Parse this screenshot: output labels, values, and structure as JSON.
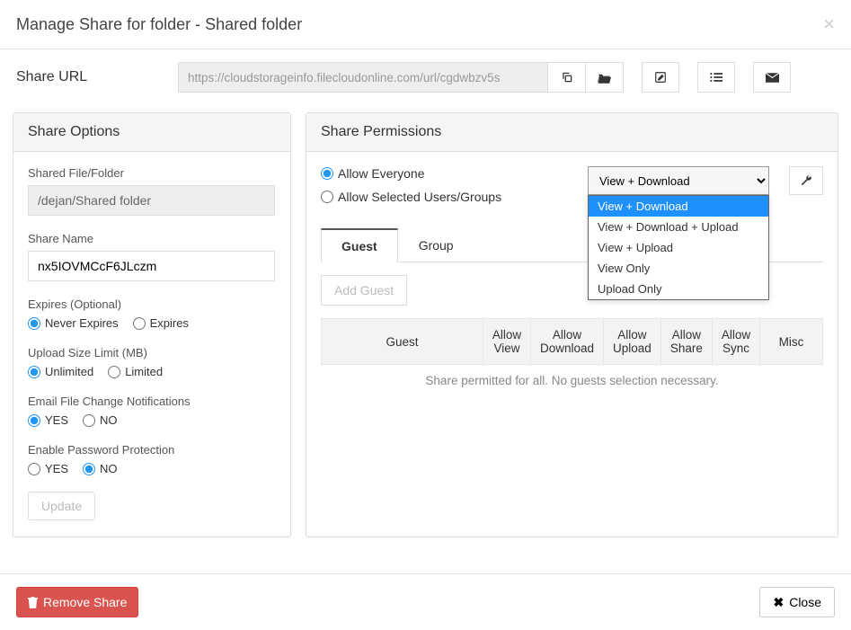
{
  "header": {
    "title": "Manage Share for folder - Shared folder"
  },
  "share_url": {
    "label": "Share URL",
    "value": "https://cloudstorageinfo.filecloudonline.com/url/cgdwbzv5s"
  },
  "share_options": {
    "heading": "Share Options",
    "shared_file": {
      "label": "Shared File/Folder",
      "value": "/dejan/Shared folder"
    },
    "share_name": {
      "label": "Share Name",
      "value": "nx5IOVMCcF6JLczm"
    },
    "expires": {
      "label": "Expires (Optional)",
      "never": "Never Expires",
      "expires": "Expires"
    },
    "upload": {
      "label": "Upload Size Limit (MB)",
      "unlimited": "Unlimited",
      "limited": "Limited"
    },
    "email_notif": {
      "label": "Email File Change Notifications",
      "yes": "YES",
      "no": "NO"
    },
    "password": {
      "label": "Enable Password Protection",
      "yes": "YES",
      "no": "NO"
    },
    "update_btn": "Update"
  },
  "share_permissions": {
    "heading": "Share Permissions",
    "allow_everyone": "Allow Everyone",
    "allow_selected": "Allow Selected Users/Groups",
    "dropdown_selected": "View + Download",
    "dropdown_options": [
      "View + Download",
      "View + Download + Upload",
      "View + Upload",
      "View Only",
      "Upload Only"
    ],
    "tabs": {
      "guest": "Guest",
      "group": "Group"
    },
    "add_guest": "Add Guest",
    "table_headers": [
      "Guest",
      "Allow View",
      "Allow Download",
      "Allow Upload",
      "Allow Share",
      "Allow Sync",
      "Misc"
    ],
    "permitted_msg": "Share permitted for all. No guests selection necessary."
  },
  "footer": {
    "remove": "Remove Share",
    "close": "Close"
  }
}
